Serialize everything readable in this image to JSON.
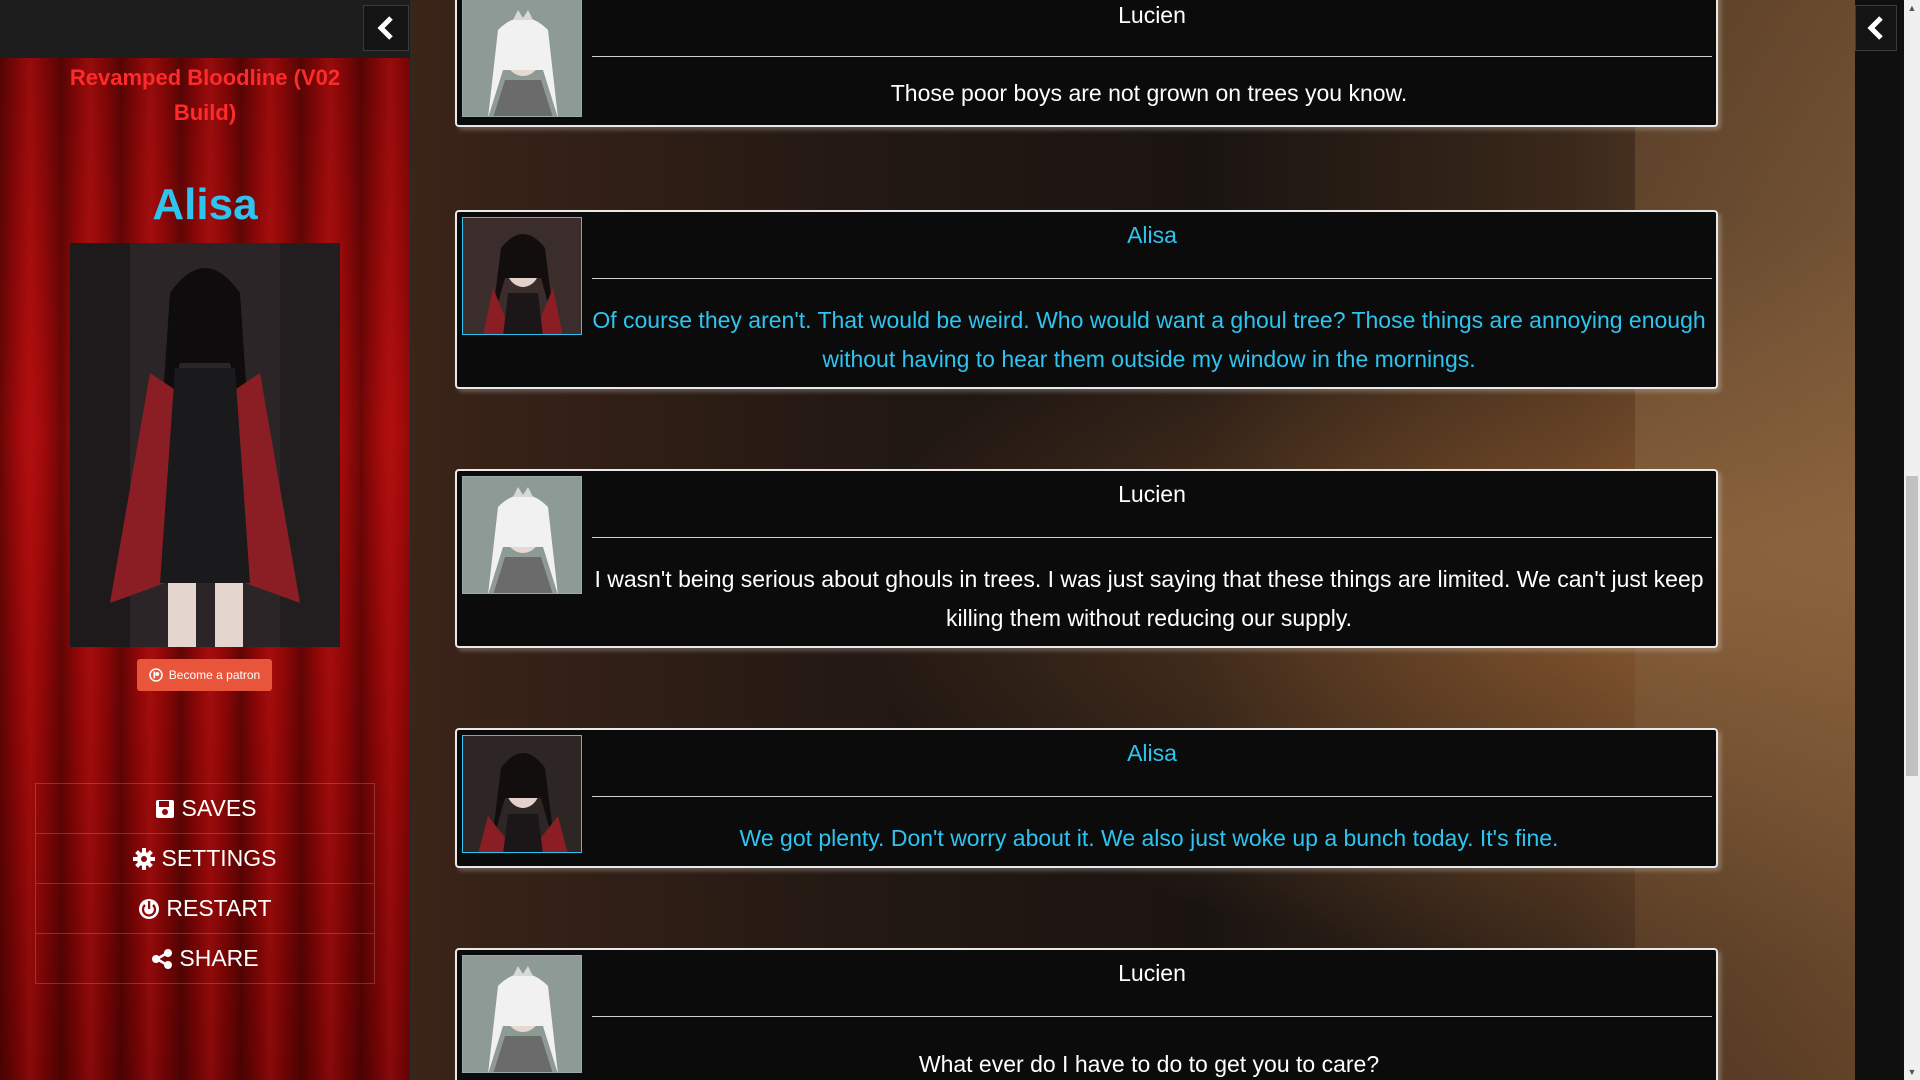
{
  "sidebar": {
    "story_title": "Revamped Bloodline (V02 Build)",
    "character_name": "Alisa",
    "patron_button": "Become a patron",
    "menu": [
      {
        "label": "SAVES",
        "icon": "save-icon"
      },
      {
        "label": "SETTINGS",
        "icon": "gear-icon"
      },
      {
        "label": "RESTART",
        "icon": "power-icon"
      },
      {
        "label": "SHARE",
        "icon": "share-icon"
      }
    ]
  },
  "passages": [
    {
      "speaker": "Lucien",
      "text": "Those poor boys are not grown on trees you know."
    },
    {
      "speaker": "Alisa",
      "text": "Of course they aren't. That would be weird. Who would want a ghoul tree? Those things are annoying enough without having to hear them outside my window in the mornings."
    },
    {
      "speaker": "Lucien",
      "text": "I wasn't being serious about ghouls in trees. I was just saying that these things are limited. We can't just keep killing them without reducing our supply."
    },
    {
      "speaker": "Alisa",
      "text": "We got plenty. Don't worry about it. We also just woke up a bunch today. It's fine."
    },
    {
      "speaker": "Lucien",
      "text": "What ever do I have to do to get you to care?"
    }
  ],
  "colors": {
    "alisa_text": "#2ec4f0",
    "lucien_text": "#ffffff",
    "story_title": "#ff2a2a",
    "patron_button": "#e8553b"
  }
}
